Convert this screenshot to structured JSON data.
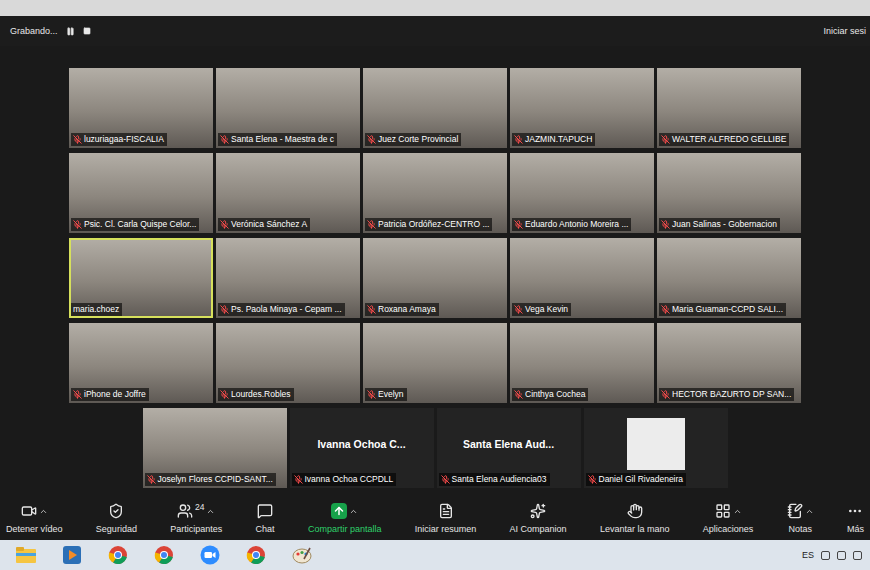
{
  "recording": {
    "label": "Grabando...",
    "paused": false
  },
  "header": {
    "signin": "Iniciar sesi"
  },
  "participants": [
    {
      "name": "luzuriagaa-FISCALIA",
      "kind": "video",
      "muted": true,
      "speaking": false
    },
    {
      "name": "Santa Elena - Maestra de c",
      "kind": "video",
      "muted": true,
      "speaking": false
    },
    {
      "name": "Juez Corte Provincial",
      "kind": "video",
      "muted": true,
      "speaking": false
    },
    {
      "name": "JAZMIN.TAPUCH",
      "kind": "video",
      "muted": true,
      "speaking": false
    },
    {
      "name": "WALTER ALFREDO GELLIBE",
      "kind": "video",
      "muted": true,
      "speaking": false
    },
    {
      "name": "Psic. Cl. Carla Quispe Celor...",
      "kind": "video",
      "muted": true,
      "speaking": false
    },
    {
      "name": "Verónica Sánchez A",
      "kind": "video",
      "muted": true,
      "speaking": false
    },
    {
      "name": "Patricia Ordóñez-CENTRO ...",
      "kind": "video",
      "muted": true,
      "speaking": false
    },
    {
      "name": "Eduardo Antonio Moreira ...",
      "kind": "video",
      "muted": true,
      "speaking": false
    },
    {
      "name": "Juan Salinas - Gobernacion",
      "kind": "video",
      "muted": true,
      "speaking": false
    },
    {
      "name": "maria.choez",
      "kind": "video",
      "muted": false,
      "speaking": true
    },
    {
      "name": "Ps. Paola Minaya - Cepam ...",
      "kind": "video",
      "muted": true,
      "speaking": false
    },
    {
      "name": "Roxana Amaya",
      "kind": "video",
      "muted": true,
      "speaking": false
    },
    {
      "name": "Vega Kevin",
      "kind": "video",
      "muted": true,
      "speaking": false
    },
    {
      "name": "Maria Guaman-CCPD SALI...",
      "kind": "video",
      "muted": true,
      "speaking": false
    },
    {
      "name": "iPhone de Joffre",
      "kind": "video",
      "muted": true,
      "speaking": false
    },
    {
      "name": "Lourdes.Robles",
      "kind": "video",
      "muted": true,
      "speaking": false
    },
    {
      "name": "Evelyn",
      "kind": "video",
      "muted": true,
      "speaking": false
    },
    {
      "name": "Cinthya Cochea",
      "kind": "video",
      "muted": true,
      "speaking": false
    },
    {
      "name": "HECTOR BAZURTO DP SAN...",
      "kind": "video",
      "muted": true,
      "speaking": false
    },
    {
      "name": "Joselyn Flores CCPID-SANT...",
      "kind": "video",
      "muted": true,
      "speaking": false
    },
    {
      "name": "Ivanna Ochoa CCPDLL",
      "kind": "name",
      "center": "Ivanna Ochoa C...",
      "muted": true,
      "speaking": false
    },
    {
      "name": "Santa Elena Audiencia03",
      "kind": "name",
      "center": "Santa Elena Aud...",
      "muted": true,
      "speaking": false
    },
    {
      "name": "Daniel Gil Rivadeneira",
      "kind": "avatar",
      "muted": true,
      "speaking": false
    }
  ],
  "toolbar": [
    {
      "label": "Detener vídeo",
      "menu": true,
      "highlight": false
    },
    {
      "label": "Seguridad",
      "menu": false,
      "highlight": false
    },
    {
      "label": "Participantes",
      "badge": "24",
      "menu": true,
      "highlight": false
    },
    {
      "label": "Chat",
      "menu": false,
      "highlight": false
    },
    {
      "label": "Compartir pantalla",
      "menu": true,
      "highlight": true
    },
    {
      "label": "Iniciar resumen",
      "menu": false,
      "highlight": false
    },
    {
      "label": "AI Companion",
      "menu": false,
      "highlight": false
    },
    {
      "label": "Levantar la mano",
      "menu": false,
      "highlight": false
    },
    {
      "label": "Aplicaciones",
      "menu": true,
      "highlight": false
    },
    {
      "label": "Notas",
      "menu": true,
      "highlight": false
    },
    {
      "label": "Más",
      "menu": false,
      "highlight": false
    }
  ],
  "tray": {
    "language": "ES"
  }
}
